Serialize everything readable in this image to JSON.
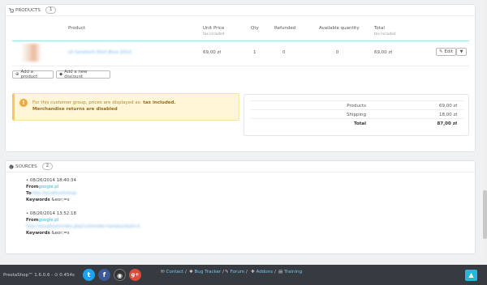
{
  "products_panel": {
    "title": "Products",
    "count": "1",
    "columns": {
      "product": "Product",
      "unit_price": "Unit Price",
      "unit_price_sub": "tax included",
      "qty": "Qty",
      "refunded": "Refunded",
      "available": "Available quantity",
      "total": "Total",
      "total_sub": "tax included"
    },
    "row": {
      "name": "Ut hendrerit Shirt Blue 2014",
      "unit_price": "69,00 zł",
      "qty": "1",
      "refunded": "0",
      "available": "0",
      "total": "69,00 zł",
      "edit_label": "Edit"
    },
    "add_product_label": "Add a product",
    "add_discount_label": "Add a new discount",
    "alert_line1": "For this customer group, prices are displayed as:",
    "alert_tax": "tax included.",
    "alert_line2": "Merchandise returns are disabled",
    "totals": [
      {
        "label": "Products",
        "value": "69,00 zł"
      },
      {
        "label": "Shipping",
        "value": "18,00 zł"
      },
      {
        "label": "Total",
        "value": "87,00 zł"
      }
    ]
  },
  "sources_panel": {
    "title": "Sources",
    "count": "2",
    "items": [
      {
        "date": "08/26/2014 18:40:34",
        "from_label": "From",
        "from": "google.pl",
        "to_label": "To",
        "to": "http://localhost/shop",
        "kw_label": "Keywords",
        "kw": "&eor;=s"
      },
      {
        "date": "08/26/2014 13:52:18",
        "from_label": "From",
        "from": "google.pl",
        "url": "http://localhost/index.php?controller=product&id=3",
        "kw_label": "Keywords",
        "kw": "&eor;=s"
      }
    ]
  },
  "footer": {
    "brand": "PrestaShop™ 1.6.0.6 - ⊙ 0.454s",
    "links": [
      "Contact",
      "Bug Tracker",
      "Forum",
      "Addons",
      "Training"
    ],
    "social": [
      {
        "icon": "twitter-icon",
        "glyph": "t",
        "color": "#1da1f2"
      },
      {
        "icon": "facebook-icon",
        "glyph": "f",
        "color": "#3b5998"
      },
      {
        "icon": "github-icon",
        "glyph": "◉",
        "color": "#333333"
      },
      {
        "icon": "google-plus-icon",
        "glyph": "g+",
        "color": "#dd4b39"
      }
    ]
  }
}
